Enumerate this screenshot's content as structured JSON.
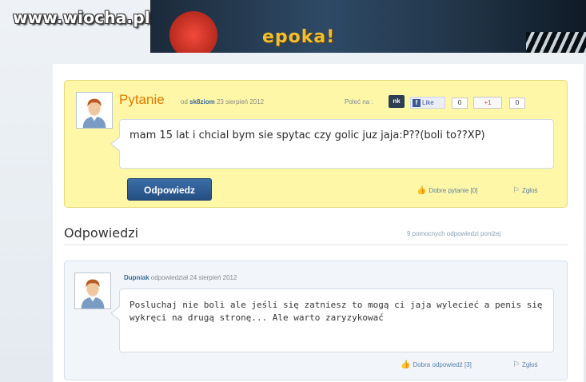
{
  "watermark": "www.wiocha.pl",
  "banner": {
    "text": "epoka!"
  },
  "question": {
    "title": "Pytanie",
    "by_label": "od",
    "author": "sk8ziom",
    "date": "23 sierpień 2012",
    "recommend_label": "Poleć na :",
    "nk_label": "nk",
    "fb_like_label": "Like",
    "fb_count": "0",
    "gplus_label": "+1",
    "gplus_count": "0",
    "text": "mam 15 lat i chcial bym sie spytac czy golic juz jaja:P??(boli to??XP)",
    "answer_button": "Odpowiedz",
    "good_question": "Dobre pytanie [0]",
    "report": "Zgłoś"
  },
  "answers_section": {
    "title": "Odpowiedzi",
    "helpful_count": "9 pomocnych odpowiedzi poniżej"
  },
  "answer": {
    "author": "Dupniak",
    "replied_label": "odpowiedział",
    "date": "24 sierpień 2012",
    "text": "Posluchaj nie boli ale jeśli się zatniesz to mogą ci jaja wylecieć a penis się wykręci na drugą stronę... Ale warto zaryzykować",
    "good_answer": "Dobra odpowiedź [3]",
    "report": "Zgłoś"
  },
  "colors": {
    "question_bg": "#fff7a8",
    "answer_bg": "#f2f6fa",
    "accent_orange": "#e07a00",
    "button_blue": "#244f82"
  }
}
